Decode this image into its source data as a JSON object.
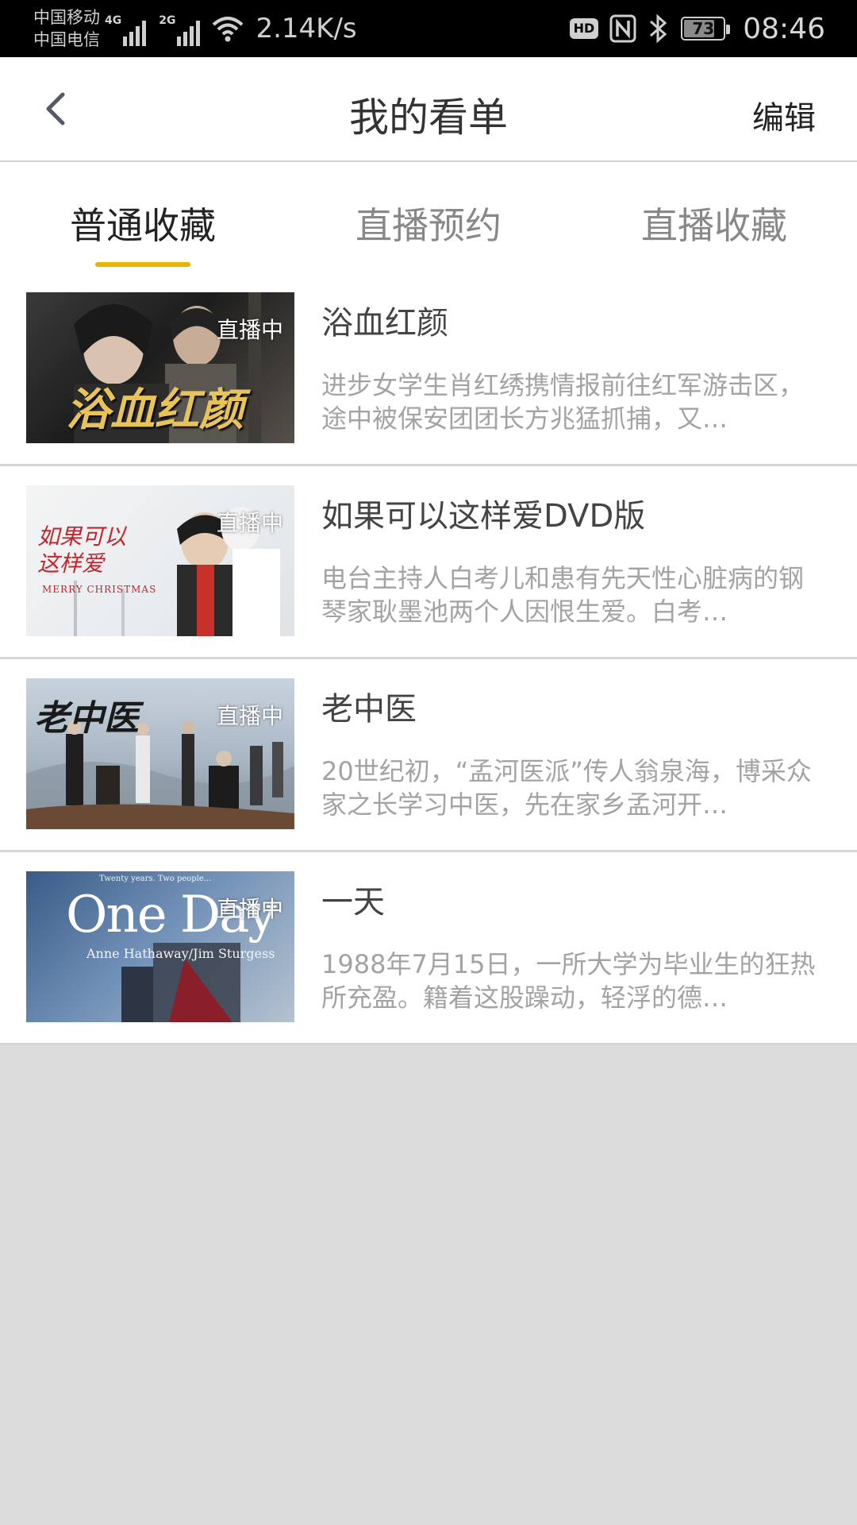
{
  "status_bar": {
    "carrier1": "中国移动",
    "carrier2": "中国电信",
    "sig1_tag": "4G",
    "sig2_tag": "2G",
    "net_speed": "2.14K/s",
    "hd_label": "HD",
    "battery_level": "73",
    "time": "08:46"
  },
  "header": {
    "title": "我的看单",
    "edit_label": "编辑"
  },
  "colors": {
    "accent": "#e8b400"
  },
  "tabs": [
    {
      "label": "普通收藏",
      "active": true
    },
    {
      "label": "直播预约",
      "active": false
    },
    {
      "label": "直播收藏",
      "active": false
    }
  ],
  "items": [
    {
      "live_badge": "直播中",
      "title": "浴血红颜",
      "description": "进步女学生肖红绣携情报前往红军游击区，途中被保安团团长方兆猛抓捕，又…",
      "poster_text": "浴血红颜"
    },
    {
      "live_badge": "直播中",
      "title": "如果可以这样爱DVD版",
      "description": "电台主持人白考儿和患有先天性心脏病的钢琴家耿墨池两个人因恨生爱。白考…",
      "poster_text": "如果可以这样爱",
      "poster_subtitle": "MERRY CHRISTMAS"
    },
    {
      "live_badge": "直播中",
      "title": "老中医",
      "description": "20世纪初，“孟河医派”传人翁泉海，博采众家之长学习中医，先在家乡孟河开…",
      "poster_text": "老中医"
    },
    {
      "live_badge": "直播中",
      "title": "一天",
      "description": "1988年7月15日，一所大学为毕业生的狂热所充盈。籍着这股躁动，轻浮的德…",
      "poster_text": "One Day",
      "poster_tagline": "Twenty years. Two people...",
      "poster_cast": "Anne Hathaway/Jim Sturgess"
    }
  ]
}
